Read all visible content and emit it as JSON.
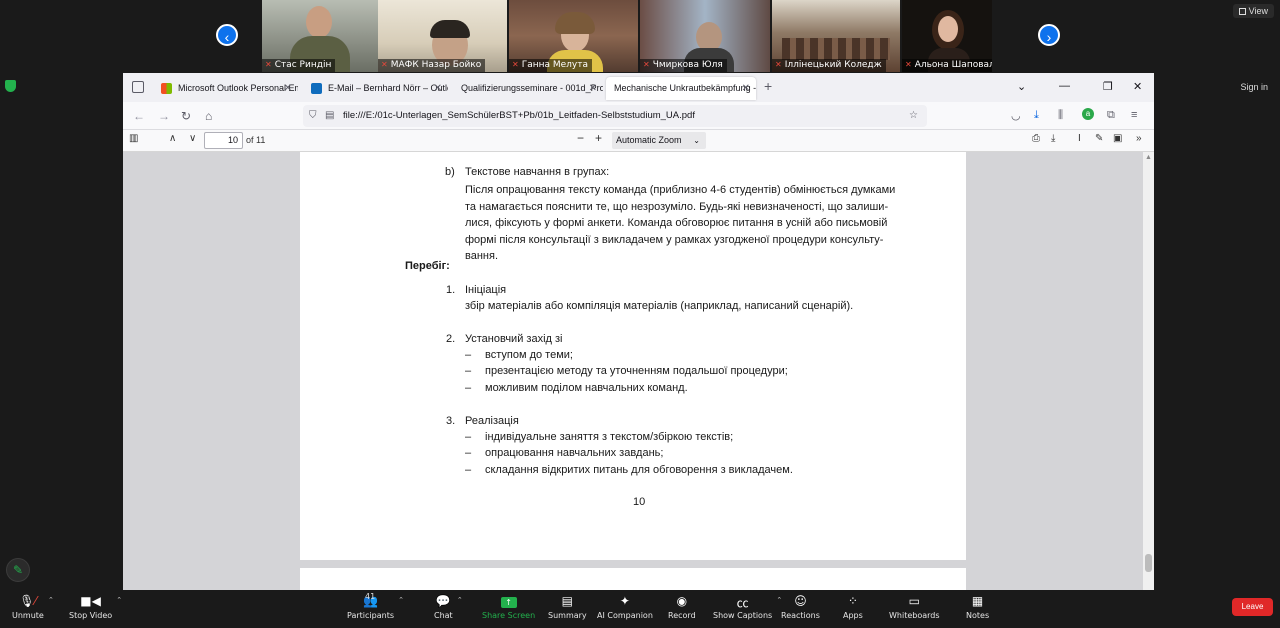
{
  "participants": {
    "prev_icon": "chevron-left-icon",
    "next_icon": "chevron-right-icon",
    "tiles": [
      {
        "name": "Стас Риндін"
      },
      {
        "name": "МАФК Назар Бойко"
      },
      {
        "name": "Ганна Мелута"
      },
      {
        "name": "Чмиркова Юля"
      },
      {
        "name": "Іллінецький Коледж"
      },
      {
        "name": "Альона Шаповал"
      }
    ],
    "view_label": "View"
  },
  "zoom_corner": {
    "signin_label": "Sign in"
  },
  "browser": {
    "tabs": [
      {
        "label": "Microsoft Outlook Personal Email",
        "favicon_color": "#f25022"
      },
      {
        "label": "E-Mail – Bernhard Nörr – Outlook",
        "favicon_color": "#0f6cbd"
      },
      {
        "label": "Qualifizierungsseminare - 001d_Pro",
        "favicon_color": ""
      },
      {
        "label": "Mechanische Unkrautbekämpfung - L",
        "favicon_color": ""
      }
    ],
    "url": "file:///E:/01c-Unterlagen_SemSchülerBST+Pb/01b_Leitfaden-Selbststudium_UA.pdf"
  },
  "pdf_toolbar": {
    "current_page": "10",
    "total_pages": "of 11",
    "zoom": "Automatic Zoom"
  },
  "document": {
    "b_marker": "b)",
    "b_title": "Текстове навчання в групах:",
    "b_lines": [
      "Після опрацювання тексту команда (приблизно 4-6 студентів) обмінюється думками",
      "та намагається пояснити те, що незрозуміло. Будь-які невизначеності, що залиши-",
      "лися, фіксують у формі анкети. Команда обговорює питання в усній або письмовій",
      "формі після консультації з викладачем у рамках узгодженої процедури консульту-",
      "вання."
    ],
    "heading": "Перебіг:",
    "items": [
      {
        "num": "1.",
        "title": "Ініціація",
        "sub": "збір матеріалів або компіляція матеріалів (наприклад, написаний сценарій).",
        "bullets": []
      },
      {
        "num": "2.",
        "title": "Установчий захід зі",
        "sub": "",
        "bullets": [
          "вступом до теми;",
          "презентацією методу та уточненням подальшої процедури;",
          "можливим поділом навчальних команд."
        ]
      },
      {
        "num": "3.",
        "title": "Реалізація",
        "sub": "",
        "bullets": [
          "індивідуальне заняття з текстом/збіркою текстів;",
          "опрацювання навчальних завдань;",
          "складання відкритих питань для обговорення з викладачем."
        ]
      }
    ],
    "dash": "–",
    "page_number": "10"
  },
  "zoom_toolbar": {
    "unmute": "Unmute",
    "stop_video": "Stop Video",
    "participants": "Participants",
    "participants_count": "41",
    "chat": "Chat",
    "share_screen": "Share Screen",
    "summary": "Summary",
    "ai_companion": "AI Companion",
    "record": "Record",
    "show_captions": "Show Captions",
    "reactions": "Reactions",
    "apps": "Apps",
    "whiteboards": "Whiteboards",
    "notes": "Notes",
    "leave": "Leave",
    "accent_green": "#23b14d",
    "leave_red": "#e02828"
  }
}
